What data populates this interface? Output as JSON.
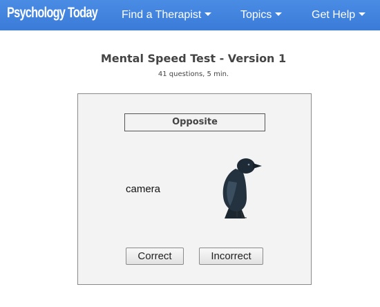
{
  "navbar": {
    "logo": "Psychology Today",
    "items": [
      {
        "label": "Find a Therapist",
        "icon": "caret-down-icon"
      },
      {
        "label": "Topics",
        "icon": "caret-down-icon"
      },
      {
        "label": "Get Help",
        "icon": "caret-down-icon"
      }
    ],
    "background_color": "#3f82dd"
  },
  "test": {
    "title": "Mental Speed Test - Version 1",
    "subtitle": "41 questions, 5 min."
  },
  "panel": {
    "instruction": "Opposite",
    "word": "camera",
    "image": "crow-icon",
    "buttons": {
      "correct": "Correct",
      "incorrect": "Incorrect"
    }
  }
}
